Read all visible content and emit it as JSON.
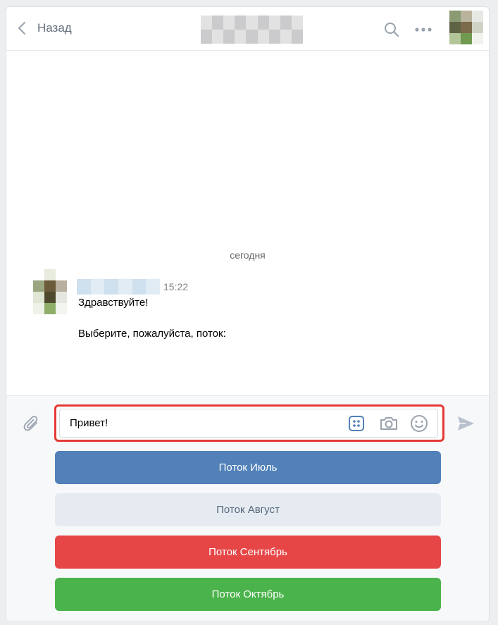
{
  "header": {
    "back_label": "Назад"
  },
  "history": {
    "date_separator": "сегодня",
    "message": {
      "time": "15:22",
      "line1": "Здравствуйте!",
      "line2": "Выберите, пожалуйста, поток:"
    }
  },
  "composer": {
    "input_value": "Привет!"
  },
  "keyboard": {
    "buttons": [
      {
        "label": "Поток Июль",
        "color": "#5181b8"
      },
      {
        "label": "Поток Август",
        "color": "#e5ebf1"
      },
      {
        "label": "Поток Сентябрь",
        "color": "#e64646"
      },
      {
        "label": "Поток Октябрь",
        "color": "#4bb34b"
      }
    ]
  },
  "icons": [
    "chevron-left-icon",
    "search-icon",
    "more-icon",
    "paperclip-icon",
    "keyboard-icon",
    "camera-icon",
    "smile-icon",
    "send-icon"
  ]
}
